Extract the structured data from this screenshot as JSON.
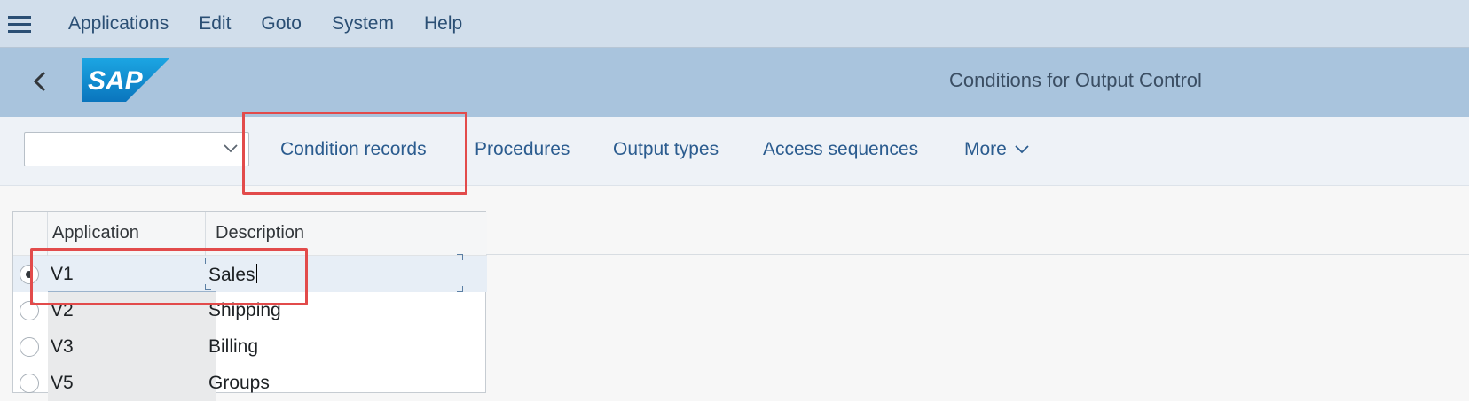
{
  "menu": {
    "items": [
      "Applications",
      "Edit",
      "Goto",
      "System",
      "Help"
    ]
  },
  "titlebar": {
    "back_icon": "chevron-left-icon",
    "logo_text": "SAP",
    "title": "Conditions for Output Control"
  },
  "toolbar": {
    "select_value": "",
    "buttons": [
      "Condition records",
      "Procedures",
      "Output types",
      "Access sequences"
    ],
    "more_label": "More"
  },
  "table": {
    "columns": [
      "Application",
      "Description"
    ],
    "rows": [
      {
        "application": "V1",
        "description": "Sales",
        "selected": true
      },
      {
        "application": "V2",
        "description": "Shipping",
        "selected": false
      },
      {
        "application": "V3",
        "description": "Billing",
        "selected": false
      },
      {
        "application": "V5",
        "description": "Groups",
        "selected": false
      }
    ]
  },
  "colors": {
    "menubar": "#d1deeb",
    "titlebar": "#a9c4dd",
    "highlight": "#e24b4b",
    "sap_blue": "#1a9ad6"
  }
}
